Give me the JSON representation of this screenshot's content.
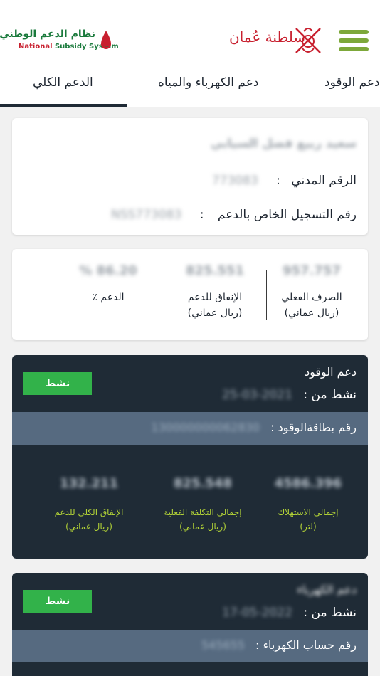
{
  "header": {
    "logo_ar": "نظام الدعم الوطني",
    "logo_en_1": "National",
    "logo_en_2": " Subsidy System",
    "gov_logo_text": "سلطنة عُمان"
  },
  "tabs": [
    {
      "label": "الدعم الكلي",
      "active": true
    },
    {
      "label": "دعم الكهرباء والمياه",
      "active": false
    },
    {
      "label": "دعم الوقود",
      "active": false
    }
  ],
  "profile": {
    "name": "سعيد ربيع فضل السيابي",
    "civil_label": "الرقم المدني",
    "civil_value": "773083",
    "reg_label": "رقم التسجيل الخاص بالدعم",
    "reg_value": "NSS773083",
    "separator": ":"
  },
  "summary": {
    "actual_value": "957.757",
    "actual_label_1": "الصرف الفعلي",
    "actual_label_2": "(ريال عماني)",
    "spend_value": "825.551",
    "spend_label_1": "الإنفاق للدعم",
    "spend_label_2": "(ريال عماني)",
    "pct_value": "% 86.20",
    "pct_label": "الدعم ٪"
  },
  "fuel": {
    "title": "دعم الوقود",
    "since_label": "نشط من :",
    "since_value": "25-03-2021",
    "status": "نشط",
    "card_label": "رقم بطاقةالوقود :",
    "card_value": "130000000062830",
    "m1_value": "4586.396",
    "m1_label_1": "إجمالي الاستهلاك",
    "m1_label_2": "(لتر)",
    "m2_value": "825.548",
    "m2_label_1": "إجمالي التكلفة الفعلية",
    "m2_label_2": "(ريال عماني)",
    "m3_value": "132.211",
    "m3_label_1": "الإنفاق الكلي للدعم",
    "m3_label_2": "(ريال عماني)"
  },
  "electricity": {
    "title": "دعم الكهرباء",
    "since_label": "نشط من :",
    "since_value": "17-05-2022",
    "status": "نشط",
    "account_label": "رقم حساب الكهرباء :",
    "account_value": "545655"
  },
  "colors": {
    "accent_green": "#7da83a",
    "badge_green": "#32b24a",
    "dark_card": "#1f2b36",
    "card_row": "#566a80",
    "metric_label": "#b2d236",
    "brand_red": "#c8202f"
  }
}
